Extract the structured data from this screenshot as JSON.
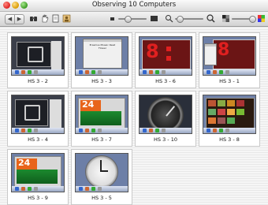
{
  "window": {
    "title": "Observing 10 Computers"
  },
  "toolbar": {
    "nav_back": "back-arrow-icon",
    "nav_forward": "forward-arrow-icon",
    "tools": [
      "binoculars-icon",
      "hand-icon",
      "document-icon",
      "person-icon"
    ],
    "view_icons": [
      "screen-size-icon",
      "zoom-icon",
      "color-icon"
    ]
  },
  "tiles": [
    {
      "label": "HS 3 - 2",
      "theme": "dark-desktop"
    },
    {
      "label": "HS 3 - 3",
      "theme": "doc-window",
      "thumb_text": "Erasmus Mosaic Read Flower"
    },
    {
      "label": "HS 3 - 6",
      "theme": "big-red",
      "thumb_text": "8"
    },
    {
      "label": "HS 3 - 1",
      "theme": "big-red",
      "thumb_text": "8"
    },
    {
      "label": "HS 3 - 4",
      "theme": "dark-desktop"
    },
    {
      "label": "HS 3 - 7",
      "theme": "score",
      "thumb_text": "24"
    },
    {
      "label": "HS 3 - 10",
      "theme": "gauge"
    },
    {
      "label": "HS 3 - 8",
      "theme": "photos"
    },
    {
      "label": "HS 3 - 9",
      "theme": "score",
      "thumb_text": "24"
    },
    {
      "label": "HS 3 - 5",
      "theme": "clock"
    }
  ],
  "colors": {
    "desktop_blue": "#6d7fa7",
    "big_red": "#c2141b",
    "score_orange": "#e8641a",
    "score_green": "#1c8a2f"
  }
}
